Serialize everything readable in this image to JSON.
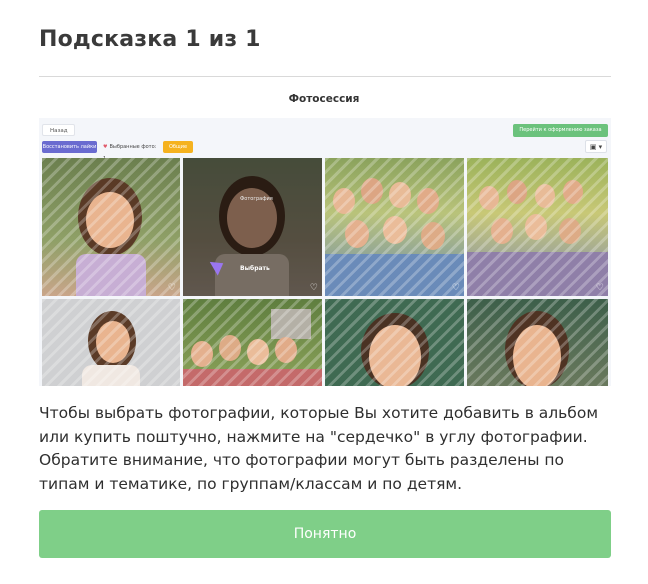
{
  "modal": {
    "title": "Подсказка 1 из 1",
    "subtitle": "Фотосессия",
    "description": "Чтобы выбрать фотографии, которые Вы хотите добавить в альбом или купить поштучно, нажмите на \"сердечко\" в углу фотографии. Обратите внимание, что фотографии могут быть разделены по типам и тематике, по группам/классам и по детям.",
    "ok_button": "Понятно"
  },
  "screenshot": {
    "back_label": "Назад",
    "order_label": "Перейти к оформлению заказа",
    "restore_label": "Восстановить лайки",
    "fav_label": "Выбранные фото: 1",
    "general_label": "Общие",
    "camera_icon": "camera-icon",
    "hint_select": "Выбрать",
    "hint_caption": "Фотография"
  },
  "colors": {
    "accent_green": "#7fcf88",
    "order_green": "#6bc27c",
    "restore_purple": "#6a6bd0",
    "general_orange": "#f5b21f",
    "heart": "#e05b6b"
  }
}
